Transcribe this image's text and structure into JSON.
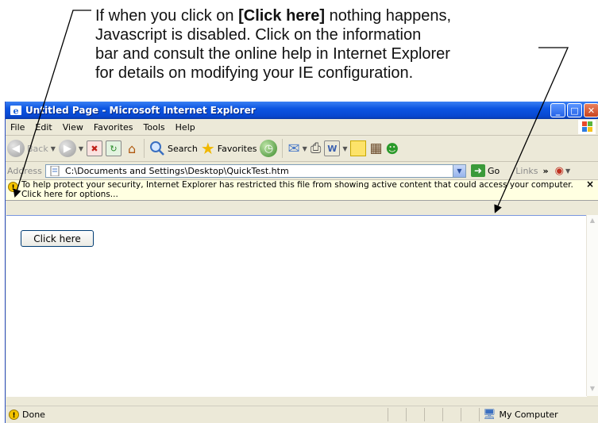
{
  "annotation": {
    "line1_pre": "If when you click on ",
    "line1_bold": "[Click here]",
    "line1_post": " nothing happens,",
    "line2": "Javascript is disabled. Click on the information",
    "line3": "bar and consult the online help in Internet Explorer",
    "line4": "for details on modifying your IE configuration."
  },
  "window": {
    "title": "Untitled Page - Microsoft Internet Explorer"
  },
  "menu": {
    "file": "File",
    "edit": "Edit",
    "view": "View",
    "favorites": "Favorites",
    "tools": "Tools",
    "help": "Help"
  },
  "toolbar": {
    "back_label": "Back",
    "search_label": "Search",
    "favorites_label": "Favorites"
  },
  "address": {
    "label": "Address",
    "value": "C:\\Documents and Settings\\Desktop\\QuickTest.htm",
    "go_label": "Go",
    "links_label": "Links",
    "links_chevron": "»"
  },
  "infobar": {
    "message": "To help protect your security, Internet Explorer has restricted this file from showing active content that could access your computer. Click here for options...",
    "close": "×"
  },
  "page": {
    "button_label": "Click here"
  },
  "status": {
    "text": "Done",
    "zone": "My Computer"
  },
  "colors": {
    "titlebar": "#0a4fd8",
    "chrome": "#ECE9D8",
    "infobar": "#FFFFE1"
  }
}
